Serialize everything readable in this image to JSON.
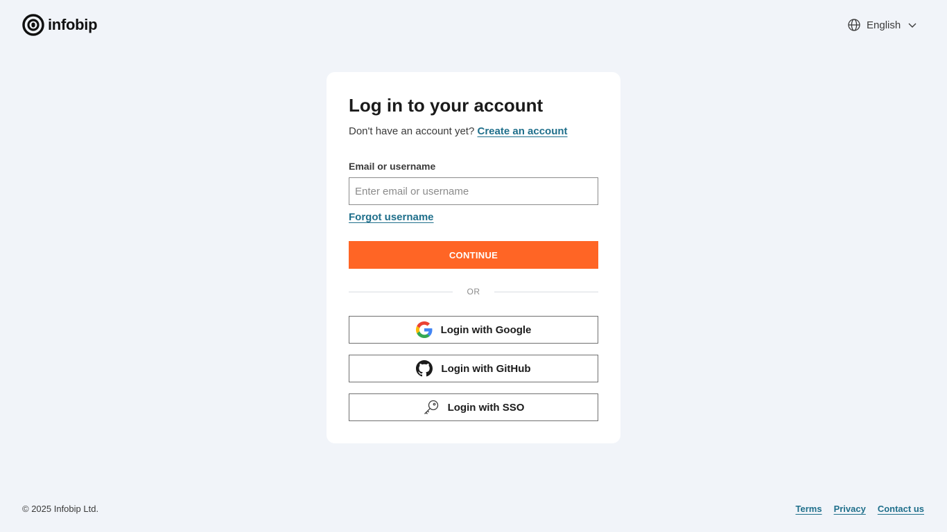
{
  "header": {
    "brand": "infobip",
    "language": {
      "selected": "English"
    }
  },
  "login": {
    "title": "Log in to your account",
    "no_account_text": "Don't have an account yet?",
    "create_account_link": "Create an account",
    "email_label": "Email or username",
    "email_placeholder": "Enter email or username",
    "email_value": "",
    "forgot_username_link": "Forgot username",
    "continue_button": "CONTINUE",
    "divider_text": "OR",
    "social_buttons": [
      {
        "label": "Login with Google",
        "icon": "google-icon"
      },
      {
        "label": "Login with GitHub",
        "icon": "github-icon"
      },
      {
        "label": "Login with SSO",
        "icon": "key-icon"
      }
    ]
  },
  "footer": {
    "copyright": "© 2025 Infobip Ltd.",
    "links": [
      "Terms",
      "Privacy",
      "Contact us"
    ]
  },
  "colors": {
    "background": "#f1f4f9",
    "accent": "#ff6525",
    "link": "#1f6f8b"
  }
}
